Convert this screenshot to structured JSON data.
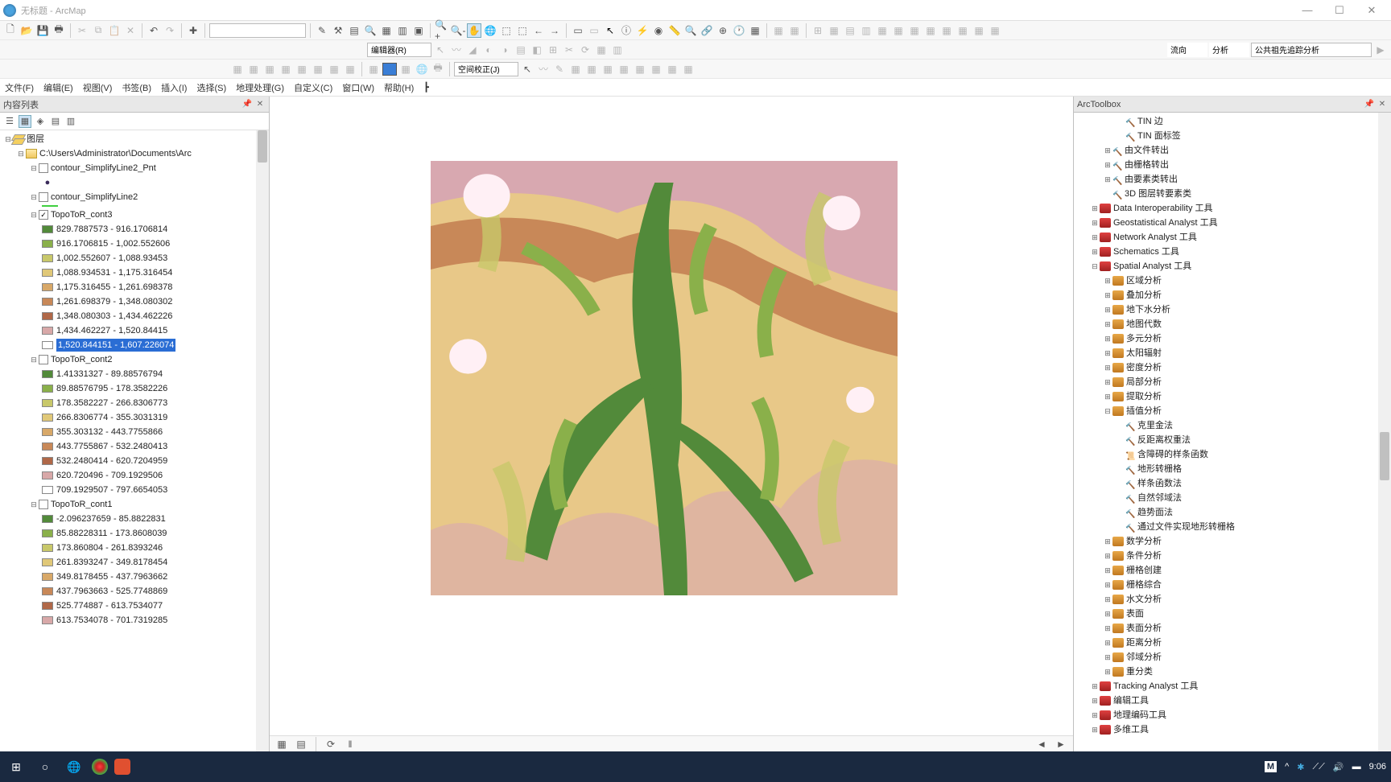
{
  "window": {
    "title": "无标题 - ArcMap"
  },
  "toolbar2": {
    "editor": "编辑器(R)",
    "spatial": "空间校正(J)"
  },
  "menu": [
    "文件(F)",
    "编辑(E)",
    "视图(V)",
    "书签(B)",
    "插入(I)",
    "选择(S)",
    "地理处理(G)",
    "自定义(C)",
    "窗口(W)",
    "帮助(H)"
  ],
  "toolbar_right": {
    "flow": "流向",
    "analysis": "分析",
    "trace": "公共祖先追踪分析"
  },
  "toc": {
    "title": "内容列表",
    "root": "图层",
    "path": "C:\\Users\\Administrator\\Documents\\Arc",
    "layers": [
      {
        "name": "contour_SimplifyLine2_Pnt",
        "checked": false,
        "symbol": "point",
        "color": "#3a2a5a"
      },
      {
        "name": "contour_SimplifyLine2",
        "checked": false,
        "symbol": "line",
        "color": "#40d040"
      },
      {
        "name": "TopoToR_cont3",
        "checked": true,
        "classes": [
          {
            "c": "#528a3a",
            "l": "829.7887573 - 916.1706814"
          },
          {
            "c": "#8ab04a",
            "l": "916.1706815 - 1,002.552606"
          },
          {
            "c": "#c8c86a",
            "l": "1,002.552607 - 1,088.93453"
          },
          {
            "c": "#e0c878",
            "l": "1,088.934531 - 1,175.316454"
          },
          {
            "c": "#d8a868",
            "l": "1,175.316455 - 1,261.698378"
          },
          {
            "c": "#c88858",
            "l": "1,261.698379 - 1,348.080302"
          },
          {
            "c": "#b06848",
            "l": "1,348.080303 - 1,434.462226"
          },
          {
            "c": "#d8a8a8",
            "l": "1,434.462227 - 1,520.84415"
          },
          {
            "c": "#ffffff",
            "l": "1,520.844151 - 1,607.226074",
            "sel": true
          }
        ]
      },
      {
        "name": "TopoToR_cont2",
        "checked": false,
        "classes": [
          {
            "c": "#528a3a",
            "l": "1.41331327 - 89.88576794"
          },
          {
            "c": "#8ab04a",
            "l": "89.88576795 - 178.3582226"
          },
          {
            "c": "#c8c86a",
            "l": "178.3582227 - 266.8306773"
          },
          {
            "c": "#e0c878",
            "l": "266.8306774 - 355.3031319"
          },
          {
            "c": "#d8a868",
            "l": "355.303132 - 443.7755866"
          },
          {
            "c": "#c88858",
            "l": "443.7755867 - 532.2480413"
          },
          {
            "c": "#b06848",
            "l": "532.2480414 - 620.7204959"
          },
          {
            "c": "#d8a8a8",
            "l": "620.720496 - 709.1929506"
          },
          {
            "c": "#ffffff",
            "l": "709.1929507 - 797.6654053"
          }
        ]
      },
      {
        "name": "TopoToR_cont1",
        "checked": false,
        "classes": [
          {
            "c": "#528a3a",
            "l": "-2.096237659 - 85.8822831"
          },
          {
            "c": "#8ab04a",
            "l": "85.88228311 - 173.8608039"
          },
          {
            "c": "#c8c86a",
            "l": "173.860804 - 261.8393246"
          },
          {
            "c": "#e0c878",
            "l": "261.8393247 - 349.8178454"
          },
          {
            "c": "#d8a868",
            "l": "349.8178455 - 437.7963662"
          },
          {
            "c": "#c88858",
            "l": "437.7963663 - 525.7748869"
          },
          {
            "c": "#b06848",
            "l": "525.774887 - 613.7534077"
          },
          {
            "c": "#d8a8a8",
            "l": "613.7534078 - 701.7319285"
          }
        ]
      }
    ]
  },
  "arctoolbox": {
    "title": "ArcToolbox",
    "items": [
      {
        "t": "tool",
        "d": 3,
        "l": "TIN 边"
      },
      {
        "t": "tool",
        "d": 3,
        "l": "TIN 面标签"
      },
      {
        "t": "tool",
        "d": 2,
        "e": "+",
        "l": "由文件转出"
      },
      {
        "t": "tool",
        "d": 2,
        "e": "+",
        "l": "由栅格转出"
      },
      {
        "t": "tool",
        "d": 2,
        "e": "+",
        "l": "由要素类转出"
      },
      {
        "t": "tool",
        "d": 2,
        "l": "3D 图层转要素类"
      },
      {
        "t": "tbx",
        "d": 1,
        "e": "+",
        "l": "Data Interoperability 工具"
      },
      {
        "t": "tbx",
        "d": 1,
        "e": "+",
        "l": "Geostatistical Analyst 工具"
      },
      {
        "t": "tbx",
        "d": 1,
        "e": "+",
        "l": "Network Analyst 工具"
      },
      {
        "t": "tbx",
        "d": 1,
        "e": "+",
        "l": "Schematics 工具"
      },
      {
        "t": "tbx",
        "d": 1,
        "e": "-",
        "l": "Spatial Analyst 工具"
      },
      {
        "t": "set",
        "d": 2,
        "e": "+",
        "l": "区域分析"
      },
      {
        "t": "set",
        "d": 2,
        "e": "+",
        "l": "叠加分析"
      },
      {
        "t": "set",
        "d": 2,
        "e": "+",
        "l": "地下水分析"
      },
      {
        "t": "set",
        "d": 2,
        "e": "+",
        "l": "地图代数"
      },
      {
        "t": "set",
        "d": 2,
        "e": "+",
        "l": "多元分析"
      },
      {
        "t": "set",
        "d": 2,
        "e": "+",
        "l": "太阳辐射"
      },
      {
        "t": "set",
        "d": 2,
        "e": "+",
        "l": "密度分析"
      },
      {
        "t": "set",
        "d": 2,
        "e": "+",
        "l": "局部分析"
      },
      {
        "t": "set",
        "d": 2,
        "e": "+",
        "l": "提取分析"
      },
      {
        "t": "set",
        "d": 2,
        "e": "-",
        "l": "插值分析"
      },
      {
        "t": "tool",
        "d": 3,
        "l": "克里金法"
      },
      {
        "t": "tool",
        "d": 3,
        "l": "反距离权重法"
      },
      {
        "t": "script",
        "d": 3,
        "l": "含障碍的样条函数"
      },
      {
        "t": "tool",
        "d": 3,
        "l": "地形转栅格"
      },
      {
        "t": "tool",
        "d": 3,
        "l": "样条函数法"
      },
      {
        "t": "tool",
        "d": 3,
        "l": "自然邻域法"
      },
      {
        "t": "tool",
        "d": 3,
        "l": "趋势面法"
      },
      {
        "t": "tool",
        "d": 3,
        "l": "通过文件实现地形转栅格"
      },
      {
        "t": "set",
        "d": 2,
        "e": "+",
        "l": "数学分析"
      },
      {
        "t": "set",
        "d": 2,
        "e": "+",
        "l": "条件分析"
      },
      {
        "t": "set",
        "d": 2,
        "e": "+",
        "l": "栅格创建"
      },
      {
        "t": "set",
        "d": 2,
        "e": "+",
        "l": "栅格综合"
      },
      {
        "t": "set",
        "d": 2,
        "e": "+",
        "l": "水文分析"
      },
      {
        "t": "set",
        "d": 2,
        "e": "+",
        "l": "表面"
      },
      {
        "t": "set",
        "d": 2,
        "e": "+",
        "l": "表面分析"
      },
      {
        "t": "set",
        "d": 2,
        "e": "+",
        "l": "距离分析"
      },
      {
        "t": "set",
        "d": 2,
        "e": "+",
        "l": "邻域分析"
      },
      {
        "t": "set",
        "d": 2,
        "e": "+",
        "l": "重分类"
      },
      {
        "t": "tbx",
        "d": 1,
        "e": "+",
        "l": "Tracking Analyst 工具"
      },
      {
        "t": "tbx",
        "d": 1,
        "e": "+",
        "l": "编辑工具"
      },
      {
        "t": "tbx",
        "d": 1,
        "e": "+",
        "l": "地理编码工具"
      },
      {
        "t": "tbx",
        "d": 1,
        "e": "+",
        "l": "多维工具"
      }
    ]
  },
  "taskbar": {
    "time": "9:06"
  }
}
